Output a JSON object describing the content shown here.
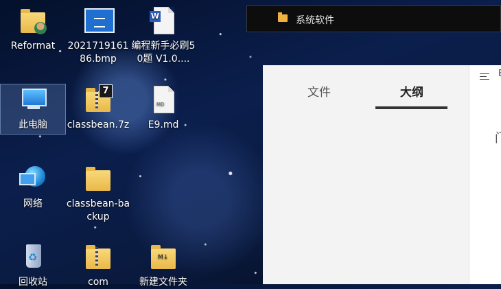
{
  "desktop": {
    "icons": [
      {
        "label": "Reformat"
      },
      {
        "label": "2021719161 86.bmp"
      },
      {
        "label": "编程新手必刷50题 V1.0...."
      },
      {
        "label": "此电脑"
      },
      {
        "label": "classbean.7z"
      },
      {
        "label": "E9.md"
      },
      {
        "label": "网络"
      },
      {
        "label": "classbean-backup"
      },
      {
        "label": "回收站"
      },
      {
        "label": "com"
      },
      {
        "label": "新建文件夹"
      }
    ]
  },
  "window": {
    "title": "系统软件",
    "tabs": [
      {
        "label": "文件",
        "active": false
      },
      {
        "label": "大纲",
        "active": true
      }
    ],
    "right_panel_letter": "E",
    "right_panel_char": "门"
  },
  "colors": {
    "accent_underline": "#333333",
    "folder": "#f0b13e"
  }
}
